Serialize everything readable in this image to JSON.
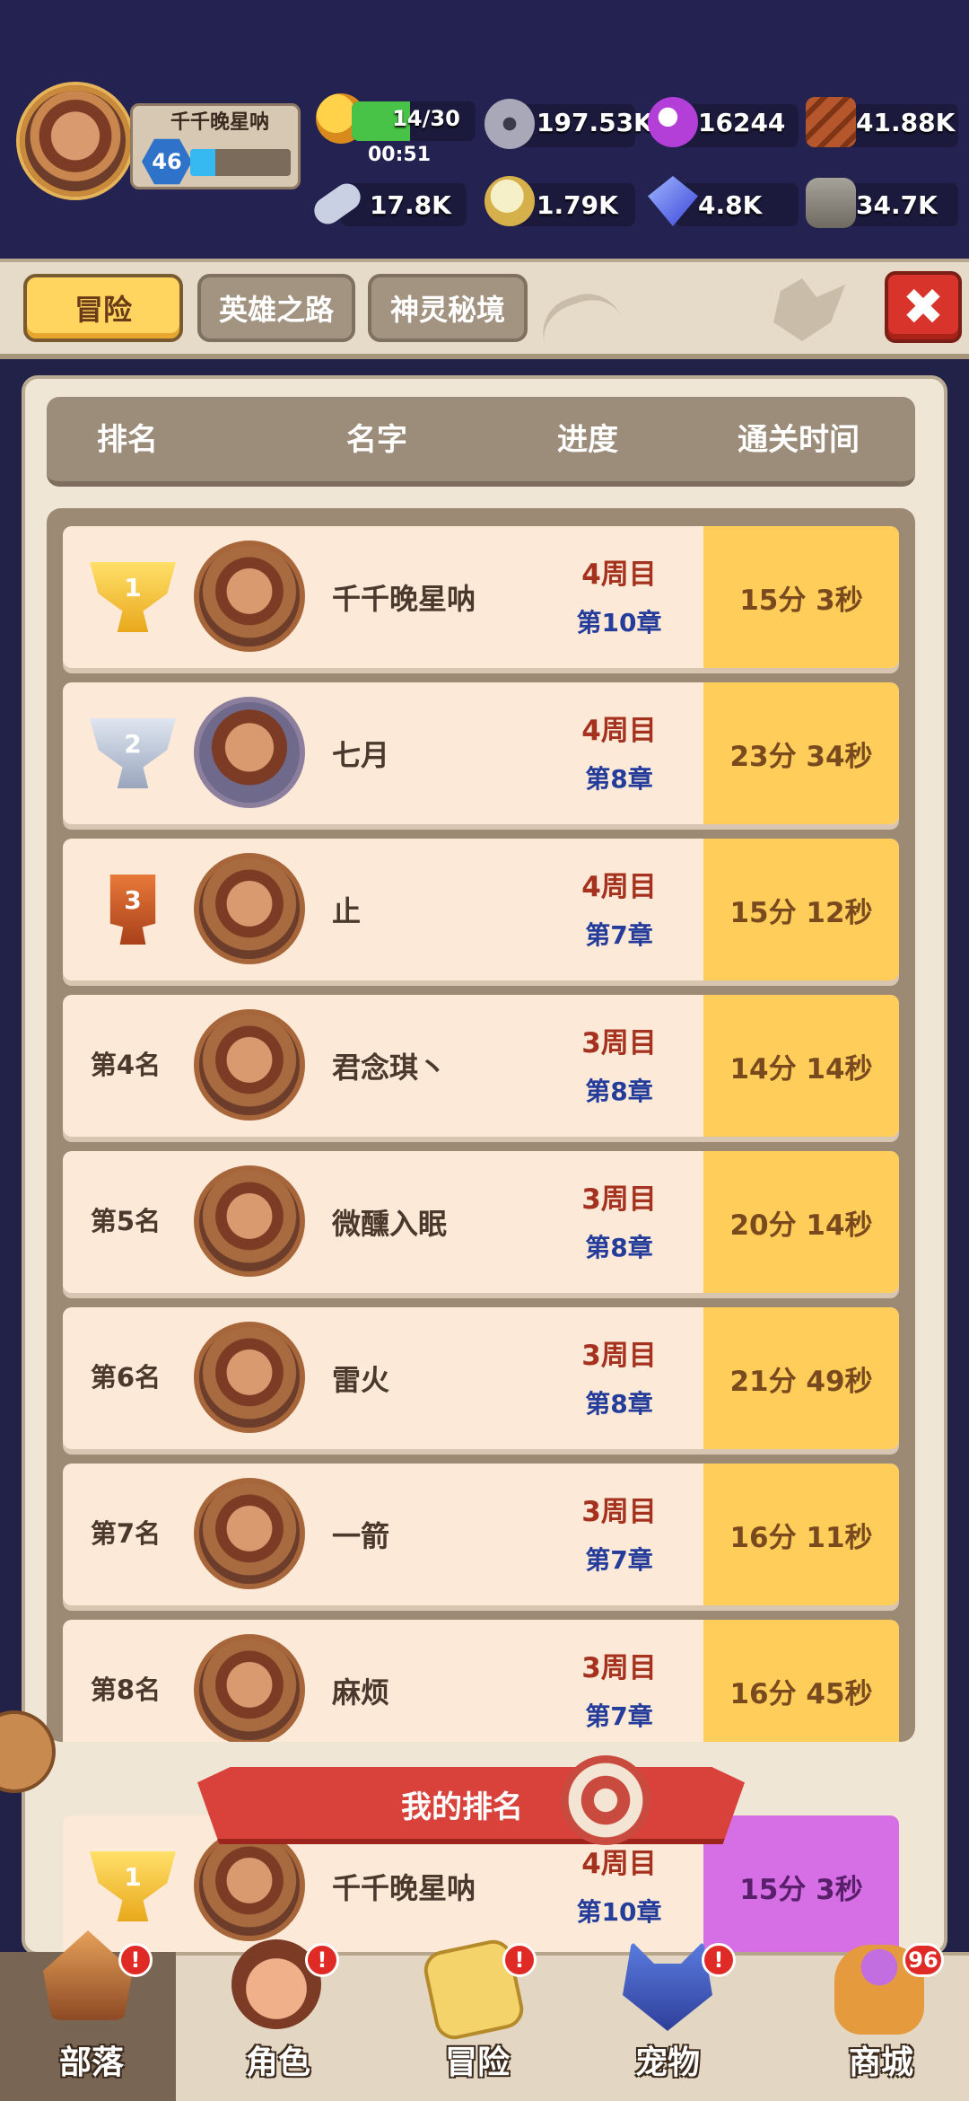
{
  "player": {
    "name": "千千晚星呐",
    "level": "46",
    "xp_fraction": 0.25
  },
  "energy": {
    "value": "14/30",
    "timer": "00:51",
    "fraction": 0.47
  },
  "resources": [
    {
      "icon": "bolt-nut-icon",
      "value": "197.53K"
    },
    {
      "icon": "purple-orb-icon",
      "value": "16244"
    },
    {
      "icon": "wood-logs-icon",
      "value": "41.88K"
    },
    {
      "icon": "bone-icon",
      "value": "17.8K"
    },
    {
      "icon": "gold-egg-icon",
      "value": "1.79K"
    },
    {
      "icon": "blue-gem-icon",
      "value": "4.8K"
    },
    {
      "icon": "stone-icon",
      "value": "34.7K"
    }
  ],
  "tabs": [
    {
      "label": "冒险",
      "active": true
    },
    {
      "label": "英雄之路",
      "active": false
    },
    {
      "label": "神灵秘境",
      "active": false
    }
  ],
  "headers": {
    "rank": "排名",
    "name": "名字",
    "progress": "进度",
    "time": "通关时间"
  },
  "rows": [
    {
      "rank": "1",
      "rank_label": "",
      "name": "千千晚星呐",
      "cycle": "4周目",
      "chapter": "第10章",
      "time": "15分 3秒"
    },
    {
      "rank": "2",
      "rank_label": "",
      "name": "七月",
      "cycle": "4周目",
      "chapter": "第8章",
      "time": "23分 34秒"
    },
    {
      "rank": "3",
      "rank_label": "",
      "name": "止",
      "cycle": "4周目",
      "chapter": "第7章",
      "time": "15分 12秒"
    },
    {
      "rank": "4",
      "rank_label": "第4名",
      "name": "君念琪丶",
      "cycle": "3周目",
      "chapter": "第8章",
      "time": "14分 14秒"
    },
    {
      "rank": "5",
      "rank_label": "第5名",
      "name": "微醺入眠",
      "cycle": "3周目",
      "chapter": "第8章",
      "time": "20分 14秒"
    },
    {
      "rank": "6",
      "rank_label": "第6名",
      "name": "雷火",
      "cycle": "3周目",
      "chapter": "第8章",
      "time": "21分 49秒"
    },
    {
      "rank": "7",
      "rank_label": "第7名",
      "name": "一箭",
      "cycle": "3周目",
      "chapter": "第7章",
      "time": "16分 11秒"
    },
    {
      "rank": "8",
      "rank_label": "第8名",
      "name": "麻烦",
      "cycle": "3周目",
      "chapter": "第7章",
      "time": "16分 45秒"
    }
  ],
  "my_rank": {
    "banner": "我的排名",
    "rank": "1",
    "name": "千千晚星呐",
    "cycle": "4周目",
    "chapter": "第10章",
    "time": "15分 3秒"
  },
  "nav": [
    {
      "label": "部落",
      "icon": "tribe-hut-icon",
      "alert": "!",
      "active": true
    },
    {
      "label": "角色",
      "icon": "hero-face-icon",
      "alert": "!",
      "active": false
    },
    {
      "label": "冒险",
      "icon": "map-scroll-icon",
      "alert": "!",
      "active": false
    },
    {
      "label": "宠物",
      "icon": "wolf-pet-icon",
      "alert": "!",
      "active": false
    },
    {
      "label": "商城",
      "icon": "shop-bag-icon",
      "alert": "96",
      "active": false
    }
  ],
  "colors": {
    "time_highlight": "#ffcd5a",
    "my_time_highlight": "#d66ee6",
    "close_red": "#d8342c",
    "active_tab": "#ffd45f"
  }
}
